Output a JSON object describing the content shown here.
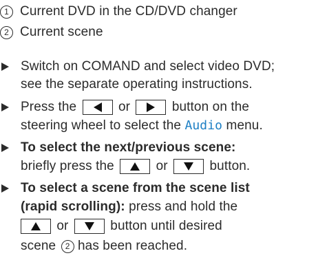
{
  "legend": [
    {
      "num": "1",
      "text": "Current DVD in the CD/DVD changer"
    },
    {
      "num": "2",
      "text": "Current scene"
    }
  ],
  "steps": [
    {
      "line1": "Switch on COMAND and select video DVD;",
      "line2": "see the separate operating instructions."
    },
    {
      "line1_pre": "Press the",
      "line1_or": "or",
      "line1_post": "button on the",
      "line2_pre": "steering wheel to select the",
      "line2_menu": "Audio",
      "line2_post": "menu.",
      "key_left_icon": "arrow-left-icon",
      "key_right_icon": "arrow-right-icon"
    },
    {
      "bold1": "To select the next/previous scene:",
      "line2_pre": "briefly press the",
      "line2_or": "or",
      "line2_post": "button.",
      "key_up_icon": "arrow-up-icon",
      "key_down_icon": "arrow-down-icon"
    },
    {
      "bold1": "To select a scene from the scene list",
      "bold2": "(rapid scrolling):",
      "line2_post": "press and hold the",
      "line3_or": "or",
      "line3_post": "button until desired",
      "line4_pre": "scene",
      "line4_num": "2",
      "line4_post": "has been reached.",
      "key_up_icon": "arrow-up-icon",
      "key_down_icon": "arrow-down-icon"
    }
  ],
  "colors": {
    "text": "#2b2b2b",
    "menu_accent": "#1d7fc4"
  }
}
